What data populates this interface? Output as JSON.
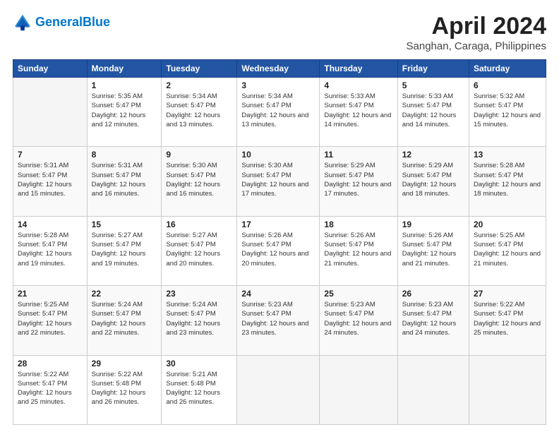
{
  "header": {
    "logo_line1": "General",
    "logo_line2": "Blue",
    "title": "April 2024",
    "subtitle": "Sanghan, Caraga, Philippines"
  },
  "weekdays": [
    "Sunday",
    "Monday",
    "Tuesday",
    "Wednesday",
    "Thursday",
    "Friday",
    "Saturday"
  ],
  "weeks": [
    [
      {
        "day": "",
        "sunrise": "",
        "sunset": "",
        "daylight": "",
        "empty": true
      },
      {
        "day": "1",
        "sunrise": "Sunrise: 5:35 AM",
        "sunset": "Sunset: 5:47 PM",
        "daylight": "Daylight: 12 hours and 12 minutes.",
        "empty": false
      },
      {
        "day": "2",
        "sunrise": "Sunrise: 5:34 AM",
        "sunset": "Sunset: 5:47 PM",
        "daylight": "Daylight: 12 hours and 13 minutes.",
        "empty": false
      },
      {
        "day": "3",
        "sunrise": "Sunrise: 5:34 AM",
        "sunset": "Sunset: 5:47 PM",
        "daylight": "Daylight: 12 hours and 13 minutes.",
        "empty": false
      },
      {
        "day": "4",
        "sunrise": "Sunrise: 5:33 AM",
        "sunset": "Sunset: 5:47 PM",
        "daylight": "Daylight: 12 hours and 14 minutes.",
        "empty": false
      },
      {
        "day": "5",
        "sunrise": "Sunrise: 5:33 AM",
        "sunset": "Sunset: 5:47 PM",
        "daylight": "Daylight: 12 hours and 14 minutes.",
        "empty": false
      },
      {
        "day": "6",
        "sunrise": "Sunrise: 5:32 AM",
        "sunset": "Sunset: 5:47 PM",
        "daylight": "Daylight: 12 hours and 15 minutes.",
        "empty": false
      }
    ],
    [
      {
        "day": "7",
        "sunrise": "Sunrise: 5:31 AM",
        "sunset": "Sunset: 5:47 PM",
        "daylight": "Daylight: 12 hours and 15 minutes.",
        "empty": false
      },
      {
        "day": "8",
        "sunrise": "Sunrise: 5:31 AM",
        "sunset": "Sunset: 5:47 PM",
        "daylight": "Daylight: 12 hours and 16 minutes.",
        "empty": false
      },
      {
        "day": "9",
        "sunrise": "Sunrise: 5:30 AM",
        "sunset": "Sunset: 5:47 PM",
        "daylight": "Daylight: 12 hours and 16 minutes.",
        "empty": false
      },
      {
        "day": "10",
        "sunrise": "Sunrise: 5:30 AM",
        "sunset": "Sunset: 5:47 PM",
        "daylight": "Daylight: 12 hours and 17 minutes.",
        "empty": false
      },
      {
        "day": "11",
        "sunrise": "Sunrise: 5:29 AM",
        "sunset": "Sunset: 5:47 PM",
        "daylight": "Daylight: 12 hours and 17 minutes.",
        "empty": false
      },
      {
        "day": "12",
        "sunrise": "Sunrise: 5:29 AM",
        "sunset": "Sunset: 5:47 PM",
        "daylight": "Daylight: 12 hours and 18 minutes.",
        "empty": false
      },
      {
        "day": "13",
        "sunrise": "Sunrise: 5:28 AM",
        "sunset": "Sunset: 5:47 PM",
        "daylight": "Daylight: 12 hours and 18 minutes.",
        "empty": false
      }
    ],
    [
      {
        "day": "14",
        "sunrise": "Sunrise: 5:28 AM",
        "sunset": "Sunset: 5:47 PM",
        "daylight": "Daylight: 12 hours and 19 minutes.",
        "empty": false
      },
      {
        "day": "15",
        "sunrise": "Sunrise: 5:27 AM",
        "sunset": "Sunset: 5:47 PM",
        "daylight": "Daylight: 12 hours and 19 minutes.",
        "empty": false
      },
      {
        "day": "16",
        "sunrise": "Sunrise: 5:27 AM",
        "sunset": "Sunset: 5:47 PM",
        "daylight": "Daylight: 12 hours and 20 minutes.",
        "empty": false
      },
      {
        "day": "17",
        "sunrise": "Sunrise: 5:26 AM",
        "sunset": "Sunset: 5:47 PM",
        "daylight": "Daylight: 12 hours and 20 minutes.",
        "empty": false
      },
      {
        "day": "18",
        "sunrise": "Sunrise: 5:26 AM",
        "sunset": "Sunset: 5:47 PM",
        "daylight": "Daylight: 12 hours and 21 minutes.",
        "empty": false
      },
      {
        "day": "19",
        "sunrise": "Sunrise: 5:26 AM",
        "sunset": "Sunset: 5:47 PM",
        "daylight": "Daylight: 12 hours and 21 minutes.",
        "empty": false
      },
      {
        "day": "20",
        "sunrise": "Sunrise: 5:25 AM",
        "sunset": "Sunset: 5:47 PM",
        "daylight": "Daylight: 12 hours and 21 minutes.",
        "empty": false
      }
    ],
    [
      {
        "day": "21",
        "sunrise": "Sunrise: 5:25 AM",
        "sunset": "Sunset: 5:47 PM",
        "daylight": "Daylight: 12 hours and 22 minutes.",
        "empty": false
      },
      {
        "day": "22",
        "sunrise": "Sunrise: 5:24 AM",
        "sunset": "Sunset: 5:47 PM",
        "daylight": "Daylight: 12 hours and 22 minutes.",
        "empty": false
      },
      {
        "day": "23",
        "sunrise": "Sunrise: 5:24 AM",
        "sunset": "Sunset: 5:47 PM",
        "daylight": "Daylight: 12 hours and 23 minutes.",
        "empty": false
      },
      {
        "day": "24",
        "sunrise": "Sunrise: 5:23 AM",
        "sunset": "Sunset: 5:47 PM",
        "daylight": "Daylight: 12 hours and 23 minutes.",
        "empty": false
      },
      {
        "day": "25",
        "sunrise": "Sunrise: 5:23 AM",
        "sunset": "Sunset: 5:47 PM",
        "daylight": "Daylight: 12 hours and 24 minutes.",
        "empty": false
      },
      {
        "day": "26",
        "sunrise": "Sunrise: 5:23 AM",
        "sunset": "Sunset: 5:47 PM",
        "daylight": "Daylight: 12 hours and 24 minutes.",
        "empty": false
      },
      {
        "day": "27",
        "sunrise": "Sunrise: 5:22 AM",
        "sunset": "Sunset: 5:47 PM",
        "daylight": "Daylight: 12 hours and 25 minutes.",
        "empty": false
      }
    ],
    [
      {
        "day": "28",
        "sunrise": "Sunrise: 5:22 AM",
        "sunset": "Sunset: 5:47 PM",
        "daylight": "Daylight: 12 hours and 25 minutes.",
        "empty": false
      },
      {
        "day": "29",
        "sunrise": "Sunrise: 5:22 AM",
        "sunset": "Sunset: 5:48 PM",
        "daylight": "Daylight: 12 hours and 26 minutes.",
        "empty": false
      },
      {
        "day": "30",
        "sunrise": "Sunrise: 5:21 AM",
        "sunset": "Sunset: 5:48 PM",
        "daylight": "Daylight: 12 hours and 26 minutes.",
        "empty": false
      },
      {
        "day": "",
        "sunrise": "",
        "sunset": "",
        "daylight": "",
        "empty": true
      },
      {
        "day": "",
        "sunrise": "",
        "sunset": "",
        "daylight": "",
        "empty": true
      },
      {
        "day": "",
        "sunrise": "",
        "sunset": "",
        "daylight": "",
        "empty": true
      },
      {
        "day": "",
        "sunrise": "",
        "sunset": "",
        "daylight": "",
        "empty": true
      }
    ]
  ]
}
